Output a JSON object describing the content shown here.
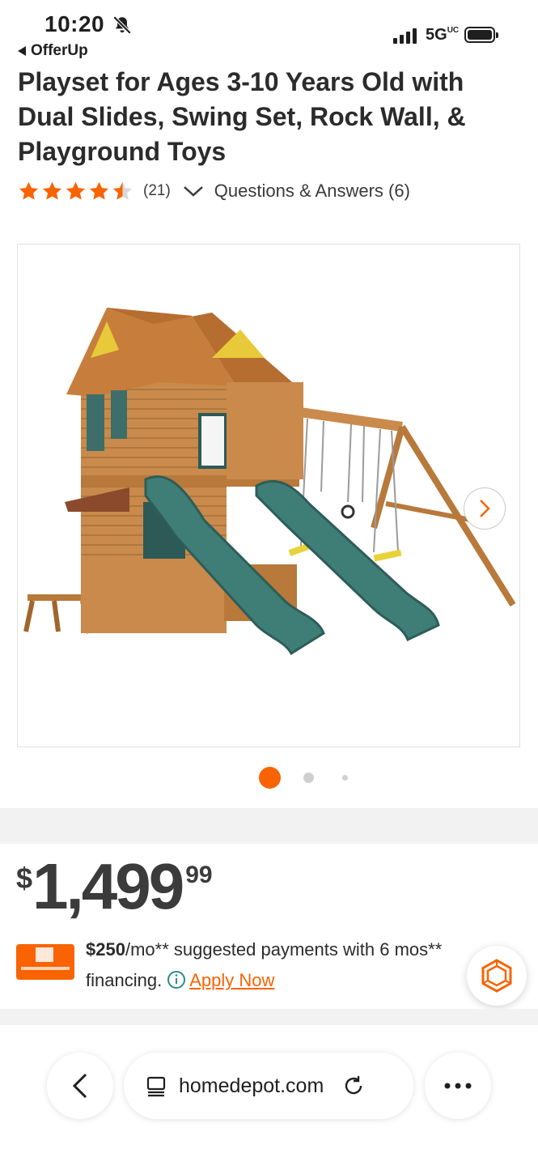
{
  "status_bar": {
    "time": "10:20",
    "back_app": "OfferUp",
    "network": "5G",
    "network_sup": "UC"
  },
  "product": {
    "title": "Playset for Ages 3-10 Years Old with Dual Slides, Swing Set, Rock Wall, & Playground Toys",
    "rating": 4.5,
    "rating_count": "(21)",
    "qa_label": "Questions & Answers (6)"
  },
  "gallery": {
    "image_alt": "Wooden playset with two green slides and swing set",
    "active_index": 0,
    "total": 3
  },
  "price": {
    "currency": "$",
    "whole": "1,499",
    "cents": "99"
  },
  "financing": {
    "monthly": "$250",
    "text_1": "/mo** suggested payments with 6 mos**",
    "text_2": "financing.",
    "apply_label": "Apply Now"
  },
  "browser": {
    "url": "homedepot.com"
  },
  "colors": {
    "accent": "#f96302",
    "star": "#f96302",
    "text": "#2b2b2b"
  }
}
